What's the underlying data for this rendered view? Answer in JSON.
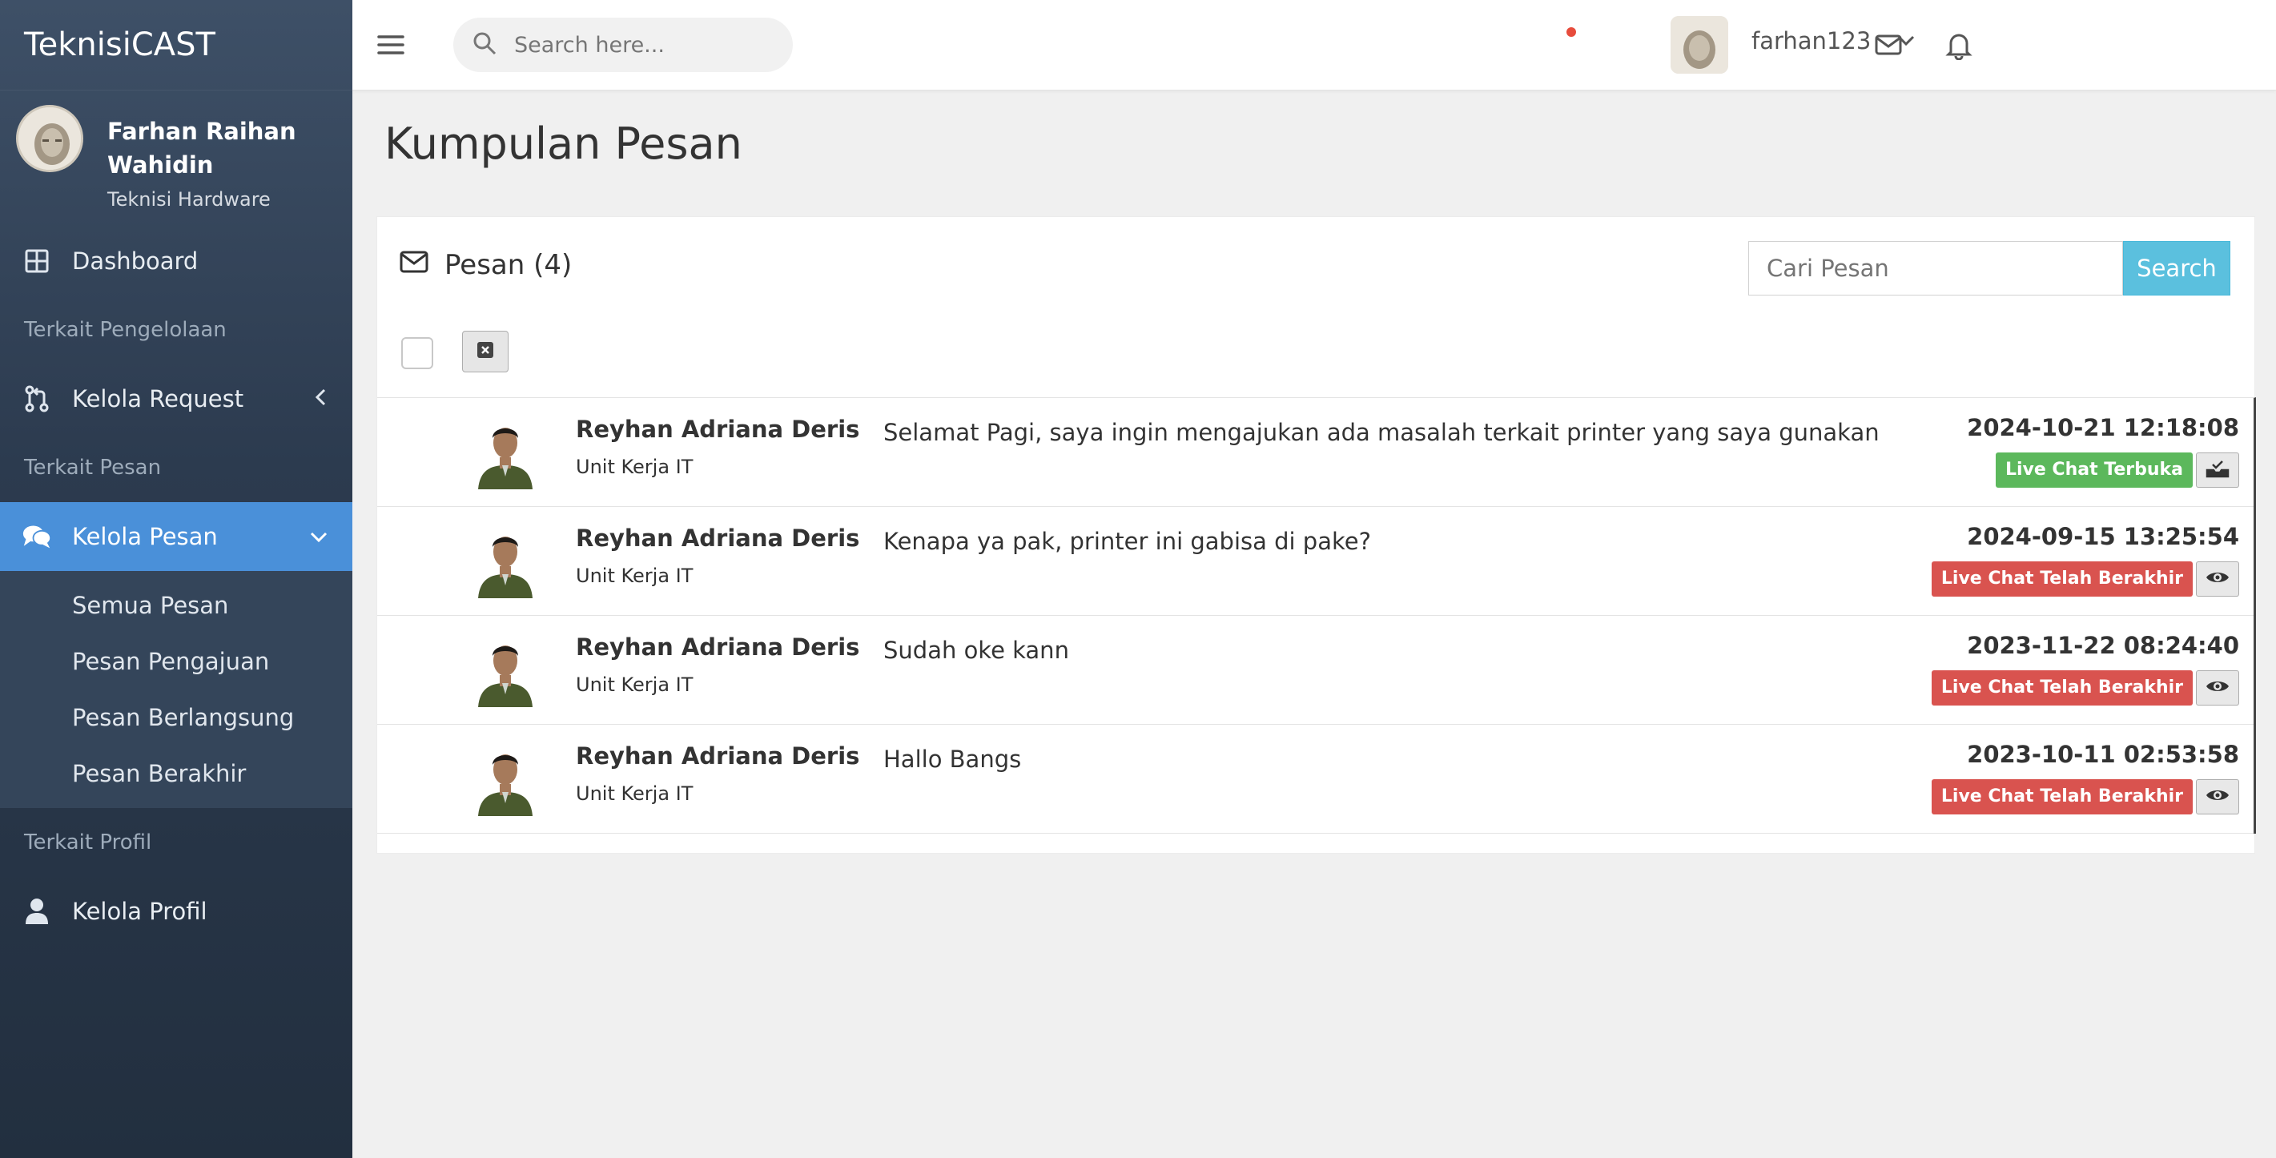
{
  "app": {
    "brand": "TeknisiCAST"
  },
  "profile": {
    "name": "Farhan Raihan Wahidin",
    "role": "Teknisi Hardware"
  },
  "sidebar": {
    "dashboard": "Dashboard",
    "header_pengelolaan": "Terkait Pengelolaan",
    "kelola_request": "Kelola Request",
    "header_pesan": "Terkait Pesan",
    "kelola_pesan": "Kelola Pesan",
    "submenu": [
      "Semua Pesan",
      "Pesan Pengajuan",
      "Pesan Berlangsung",
      "Pesan Berakhir"
    ],
    "header_profil": "Terkait Profil",
    "kelola_profil": "Kelola Profil"
  },
  "topbar": {
    "search_placeholder": "Search here...",
    "username": "farhan123"
  },
  "page": {
    "title": "Kumpulan Pesan"
  },
  "panel": {
    "title": "Pesan (4)",
    "search_placeholder": "Cari Pesan",
    "search_button": "Search"
  },
  "messages": [
    {
      "sender": "Reyhan Adriana Deris",
      "unit": "Unit Kerja IT",
      "text": "Selamat Pagi, saya ingin mengajukan ada masalah terkait printer yang saya gunakan",
      "date": "2024-10-21 12:18:08",
      "status": "Live Chat Terbuka",
      "status_color": "#5cb85c",
      "action_icon": "inbox-check-icon"
    },
    {
      "sender": "Reyhan Adriana Deris",
      "unit": "Unit Kerja IT",
      "text": "Kenapa ya pak, printer ini gabisa di pake?",
      "date": "2024-09-15 13:25:54",
      "status": "Live Chat Telah Berakhir",
      "status_color": "#d9534f",
      "action_icon": "eye-icon"
    },
    {
      "sender": "Reyhan Adriana Deris",
      "unit": "Unit Kerja IT",
      "text": "Sudah oke kann",
      "date": "2023-11-22 08:24:40",
      "status": "Live Chat Telah Berakhir",
      "status_color": "#d9534f",
      "action_icon": "eye-icon"
    },
    {
      "sender": "Reyhan Adriana Deris",
      "unit": "Unit Kerja IT",
      "text": "Hallo Bangs",
      "date": "2023-10-11 02:53:58",
      "status": "Live Chat Telah Berakhir",
      "status_color": "#d9534f",
      "action_icon": "eye-icon"
    }
  ]
}
